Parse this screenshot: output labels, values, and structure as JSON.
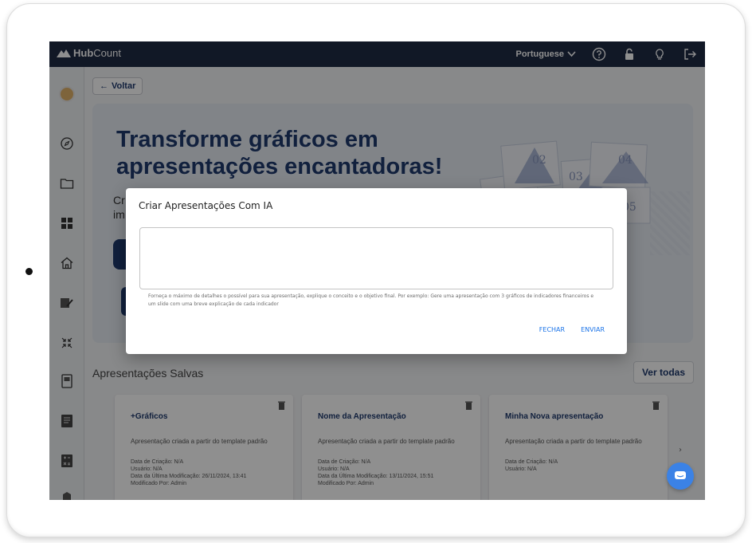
{
  "topbar": {
    "logo_hub": "Hub",
    "logo_count": "Count",
    "language": "Portuguese",
    "icons": [
      "help-icon",
      "lock-icon",
      "lightbulb-icon",
      "logout-icon"
    ]
  },
  "sidebar": {
    "icons": [
      "avatar",
      "compass-icon",
      "folder-icon",
      "grid-icon",
      "home-icon",
      "edit-icon",
      "collapse-icon",
      "report-icon",
      "document-icon",
      "calculator-icon",
      "building-icon"
    ]
  },
  "back_label": "Voltar",
  "hero": {
    "title": "Transforme gráficos em apresentações encantadoras!",
    "subtitle_line1": "Cr",
    "subtitle_line2": "im",
    "slide_numbers": [
      "02",
      "04",
      "03",
      "01",
      "05"
    ]
  },
  "saved": {
    "title": "Apresentações Salvas",
    "view_all": "Ver todas",
    "cards": [
      {
        "title": "+Gráficos",
        "description": "Apresentação criada a partir do template padrão",
        "created": "Data de Criação: N/A",
        "user": "Usuário: N/A",
        "modified": "Data da Última Modificação: 26/11/2024, 13:41",
        "modified_by": "Modificado Por: Admin"
      },
      {
        "title": "Nome da Apresentação",
        "description": "Apresentação criada a partir do template padrão",
        "created": "Data de Criação: N/A",
        "user": "Usuário: N/A",
        "modified": "Data da Última Modificação: 13/11/2024, 15:51",
        "modified_by": "Modificado Por: Admin"
      },
      {
        "title": "Minha Nova apresentação",
        "description": "Apresentação criada a partir do template padrão",
        "created": "Data de Criação: N/A",
        "user": "Usuário: N/A",
        "modified": "",
        "modified_by": ""
      }
    ]
  },
  "modal": {
    "title": "Criar Apresentações Com IA",
    "textarea_value": "",
    "helper": "Forneça o máximo de detalhes o possível para sua apresentação, explique o conceito e o objetivo final. Por exemplo: Gere uma apresentação com 3 gráficos de indicadores financeiros e um slide com uma breve explicação de cada indicador",
    "close_label": "FECHAR",
    "send_label": "ENVIAR"
  },
  "colors": {
    "brand_navy": "#1f3a6e",
    "topbar": "#1f2b45",
    "link_blue": "#1a73e8",
    "chat_blue": "#3b82e6"
  }
}
